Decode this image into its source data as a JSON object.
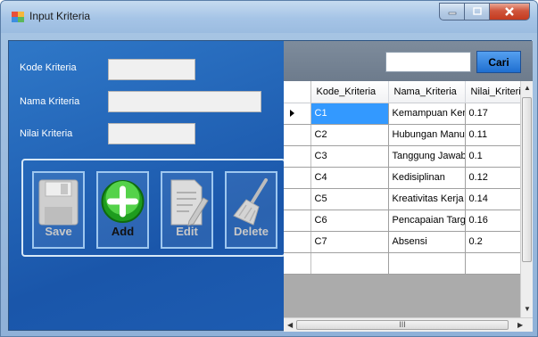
{
  "window": {
    "title": "Input Kriteria"
  },
  "form": {
    "kode_label": "Kode Kriteria",
    "nama_label": "Nama Kriteria",
    "nilai_label": "Nilai Kriteria",
    "kode_value": "",
    "nama_value": "",
    "nilai_value": ""
  },
  "buttons": {
    "save": {
      "label": "Save",
      "enabled": false,
      "icon": "floppy-disk-icon"
    },
    "add": {
      "label": "Add",
      "enabled": true,
      "icon": "plus-circle-icon"
    },
    "edit": {
      "label": "Edit",
      "enabled": false,
      "icon": "edit-document-icon"
    },
    "delete": {
      "label": "Delete",
      "enabled": false,
      "icon": "broom-icon"
    }
  },
  "search": {
    "value": "",
    "button_label": "Cari"
  },
  "table": {
    "columns": [
      "Kode_Kriteria",
      "Nama_Kriteria",
      "Nilai_Kriteri"
    ],
    "rows": [
      [
        "C1",
        "Kemampuan Kerja",
        "0.17"
      ],
      [
        "C2",
        "Hubungan Manu...",
        "0.11"
      ],
      [
        "C3",
        "Tanggung Jawab...",
        "0.1"
      ],
      [
        "C4",
        "Kedisiplinan",
        "0.12"
      ],
      [
        "C5",
        "Kreativitas Kerja",
        "0.14"
      ],
      [
        "C6",
        "Pencapaian Target",
        "0.16"
      ],
      [
        "C7",
        "Absensi",
        "0.2"
      ]
    ],
    "selected_row": 0,
    "scrollbar_grip": "III"
  },
  "colors": {
    "form_background": "#1a56aa",
    "selection": "#3399ff",
    "search_button": "#1f6fd0"
  }
}
